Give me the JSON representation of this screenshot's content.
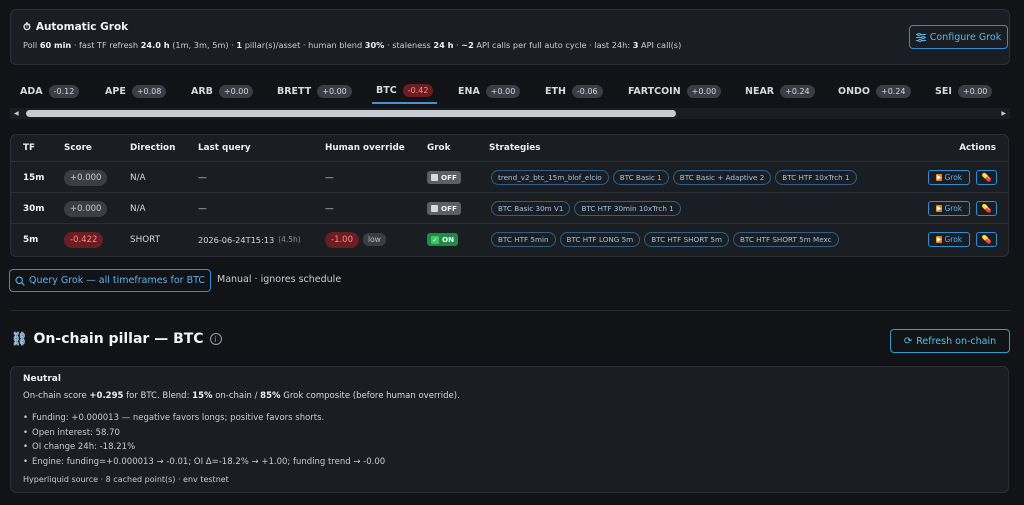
{
  "auto": {
    "icon": "stopwatch-icon",
    "title": "Automatic Grok",
    "desc": {
      "poll_prefix": "Poll ",
      "poll_val": "60 min",
      "refresh_prefix": " · fast TF refresh ",
      "refresh_val": "24.0 h",
      "refresh_suffix": " (1m, 3m, 5m) · ",
      "pillars_val": "1",
      "pillars_suffix": " pillar(s)/asset · human blend ",
      "blend_val": "30%",
      "stale_prefix": " · staleness ",
      "stale_val": "24 h",
      "calls_prefix": " · ",
      "calls_val": "~2",
      "calls_suffix": " API calls per full auto cycle · last 24h: ",
      "last_val": "3",
      "last_suffix": " API call(s)"
    },
    "configure_label": "Configure Grok"
  },
  "tabs": [
    {
      "name": "ADA",
      "value": "-0.12"
    },
    {
      "name": "APE",
      "value": "+0.08"
    },
    {
      "name": "ARB",
      "value": "+0.00"
    },
    {
      "name": "BRETT",
      "value": "+0.00"
    },
    {
      "name": "BTC",
      "value": "-0.42"
    },
    {
      "name": "ENA",
      "value": "+0.00"
    },
    {
      "name": "ETH",
      "value": "-0.06"
    },
    {
      "name": "FARTCOIN",
      "value": "+0.00"
    },
    {
      "name": "NEAR",
      "value": "+0.24"
    },
    {
      "name": "ONDO",
      "value": "+0.24"
    },
    {
      "name": "SEI",
      "value": "+0.00"
    }
  ],
  "active_tab": "BTC",
  "table": {
    "headers": {
      "tf": "TF",
      "score": "Score",
      "direction": "Direction",
      "last_query": "Last query",
      "human": "Human override",
      "grok": "Grok",
      "strategies": "Strategies",
      "actions": "Actions"
    },
    "rows": [
      {
        "tf": "15m",
        "score": "+0.000",
        "direction": "N/A",
        "last_query": "—",
        "last_query_age": "",
        "human": "—",
        "human_tag": "",
        "grok": "OFF",
        "strategies": [
          "trend_v2_btc_15m_blof_elcio",
          "BTC Basic 1",
          "BTC Basic + Adaptive 2",
          "BTC HTF 10xTrch 1"
        ]
      },
      {
        "tf": "30m",
        "score": "+0.000",
        "direction": "N/A",
        "last_query": "—",
        "last_query_age": "",
        "human": "—",
        "human_tag": "",
        "grok": "OFF",
        "strategies": [
          "BTC Basic 30m V1",
          "BTC HTF 30min 10xTrch 1"
        ]
      },
      {
        "tf": "5m",
        "score": "-0.422",
        "direction": "SHORT",
        "last_query": "2026-06-24T15:13",
        "last_query_age": "(4.5h)",
        "human": "-1.00",
        "human_tag": "low",
        "grok": "ON",
        "strategies": [
          "BTC HTF 5min",
          "BTC HTF LONG 5m",
          "BTC HTF SHORT 5m",
          "BTC HTF SHORT 5m Mexc"
        ]
      }
    ],
    "action_grok_label": "Grok",
    "action_grok_icon": "play-icon",
    "action_edit_icon": "pills-icon"
  },
  "query": {
    "button_label": "Query Grok — all timeframes for BTC",
    "button_icon": "search-icon",
    "note": "Manual · ignores schedule"
  },
  "onchain": {
    "icon": "chain-icon",
    "title": "On-chain pillar — BTC",
    "refresh_label": "Refresh on-chain",
    "state": "Neutral",
    "summary": {
      "p1": "On-chain score ",
      "score": "+0.295",
      "p2": " for BTC. Blend: ",
      "onchain_pct": "15%",
      "p3": " on-chain / ",
      "grok_pct": "85%",
      "p4": " Grok composite (before human override)."
    },
    "bullets": [
      "Funding: +0.000013 — negative favors longs; positive favors shorts.",
      "Open interest: 58.70",
      "OI change 24h: -18.21%",
      "Engine: funding=+0.000013 → -0.01; OI Δ=-18.2% → +1.00; funding trend → -0.00"
    ],
    "footer": "Hyperliquid source · 8 cached point(s) · env testnet"
  }
}
